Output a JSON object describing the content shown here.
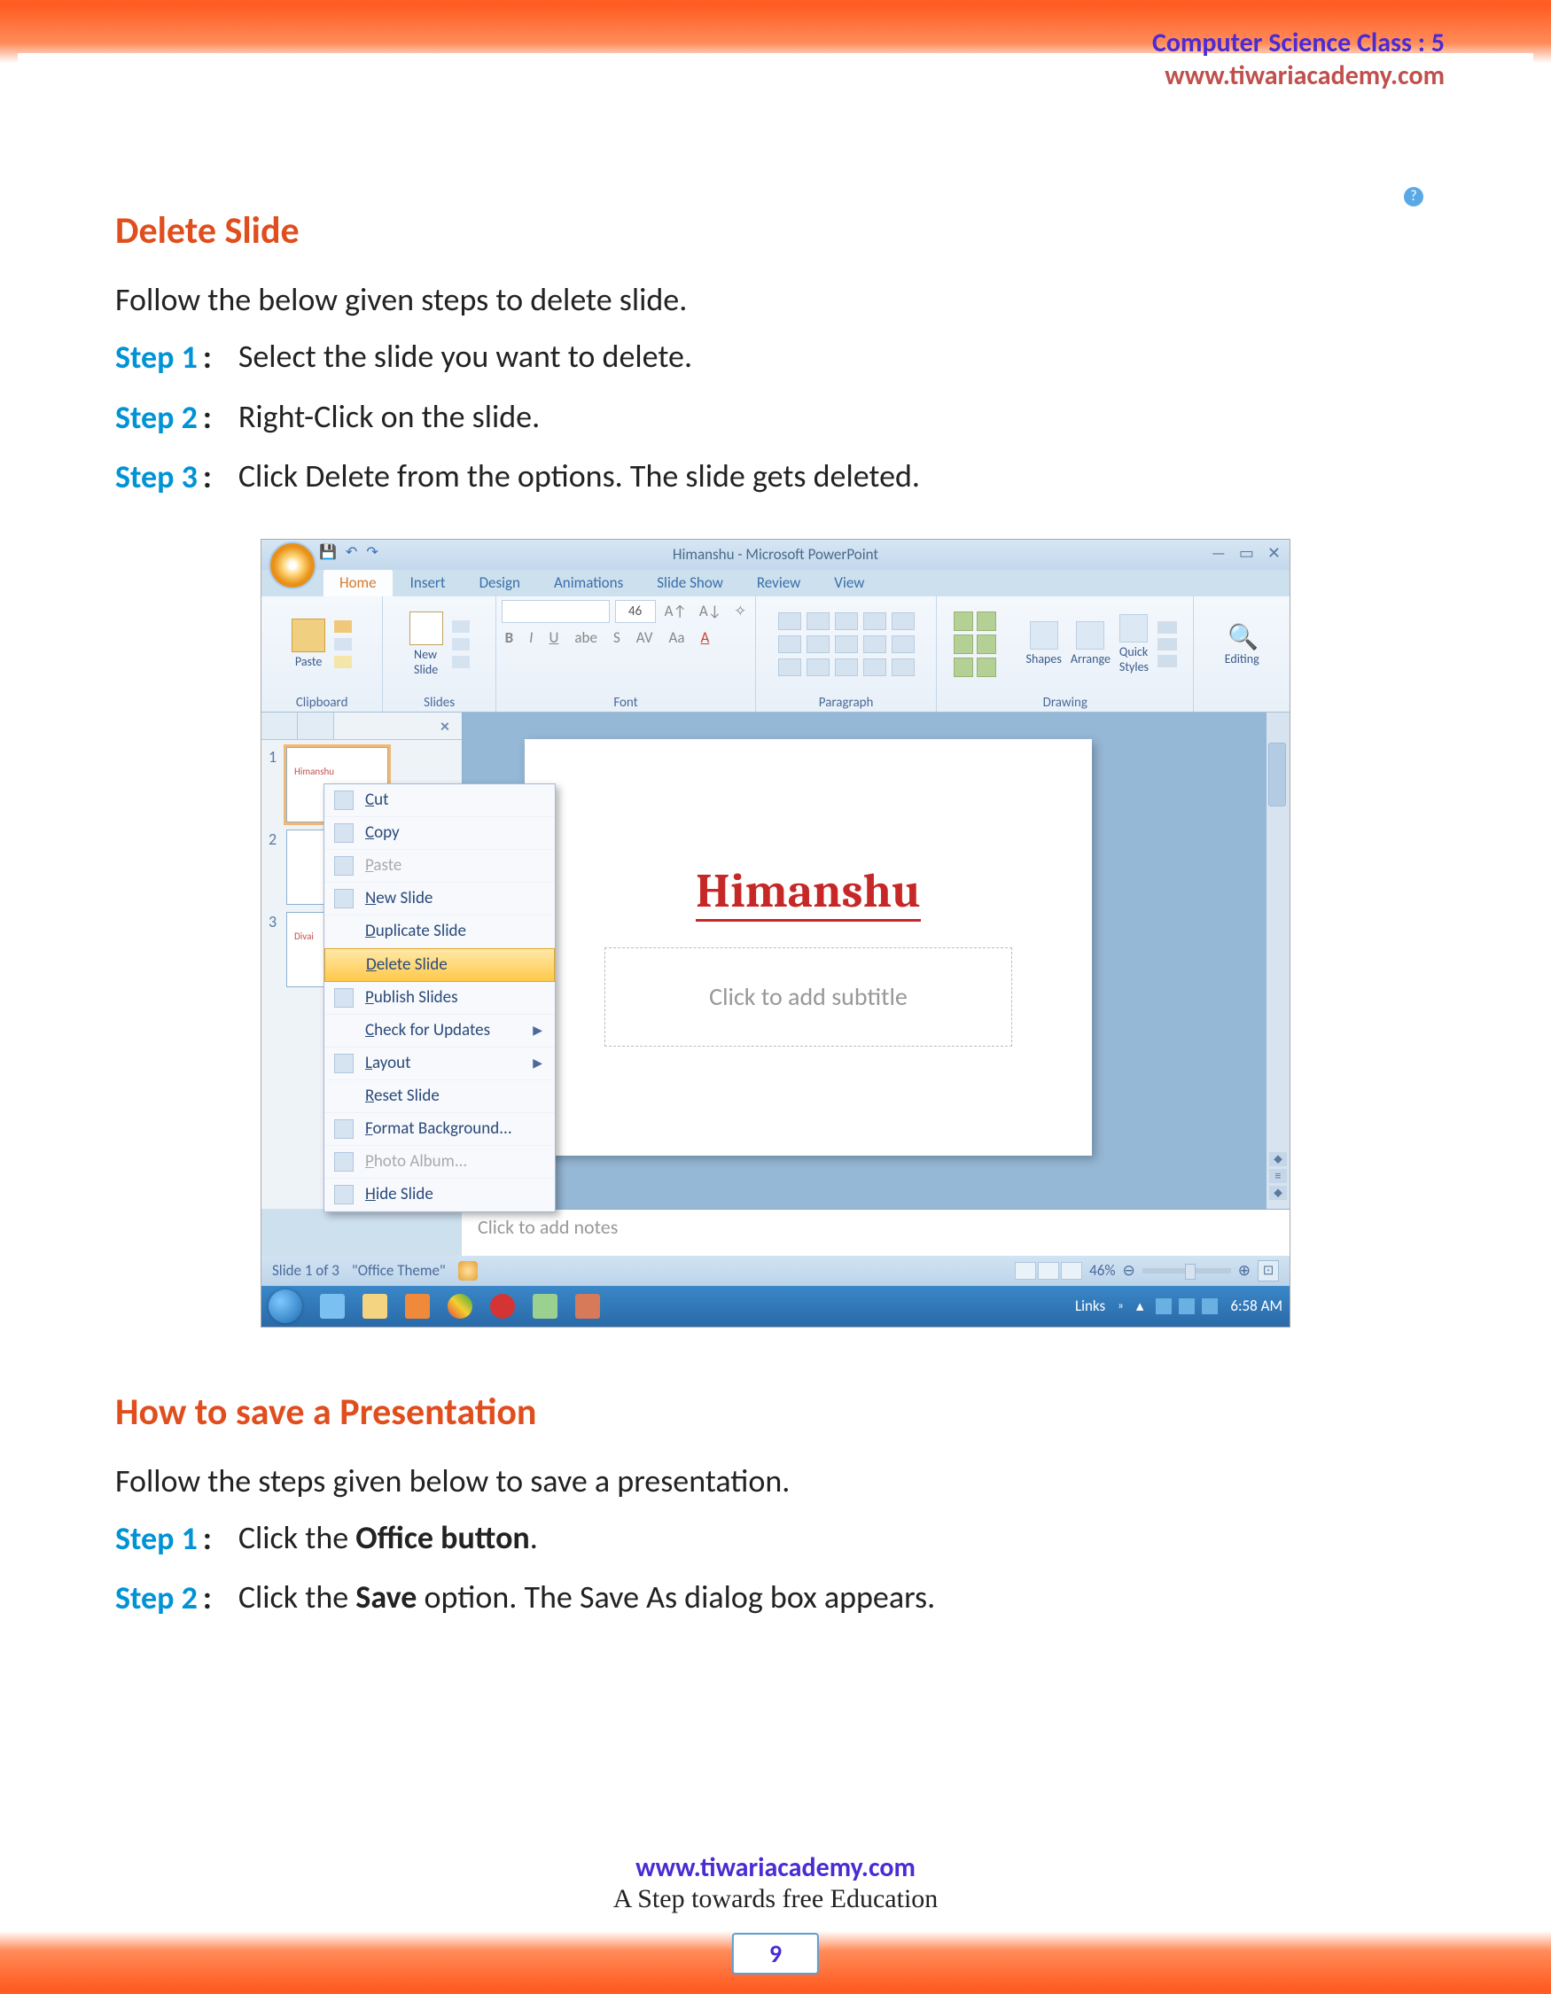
{
  "header": {
    "classLine": "Computer Science Class : 5",
    "site": "www.tiwariacademy.com"
  },
  "section1": {
    "title": "Delete Slide",
    "intro": "Follow the below given steps to delete slide.",
    "steps": [
      {
        "label": "Step 1",
        "text": "Select the slide you want to delete."
      },
      {
        "label": "Step 2",
        "text": "Right-Click on the slide."
      },
      {
        "label": "Step 3",
        "text": "Click Delete from the options. The slide gets deleted."
      }
    ]
  },
  "screenshot": {
    "title": "Himanshu - Microsoft PowerPoint",
    "tabs": [
      "Home",
      "Insert",
      "Design",
      "Animations",
      "Slide Show",
      "Review",
      "View"
    ],
    "groups": {
      "clipboard": "Clipboard",
      "slides": "Slides",
      "font": "Font",
      "paragraph": "Paragraph",
      "drawing": "Drawing",
      "editing": "Editing"
    },
    "pasteLabel": "Paste",
    "newSlideLabel": "New\nSlide",
    "fontSize": "46",
    "shapesLabel": "Shapes",
    "arrangeLabel": "Arrange",
    "quickStylesLabel": "Quick\nStyles",
    "thumbs": [
      {
        "num": "1",
        "text": "Himanshu"
      },
      {
        "num": "2",
        "text": ""
      },
      {
        "num": "3",
        "text": "Divai"
      }
    ],
    "context": [
      {
        "label": "Cut",
        "icon": true
      },
      {
        "label": "Copy",
        "icon": true
      },
      {
        "label": "Paste",
        "icon": true,
        "disabled": true
      },
      {
        "label": "New Slide",
        "icon": true
      },
      {
        "label": "Duplicate Slide"
      },
      {
        "label": "Delete Slide",
        "highlighted": true
      },
      {
        "label": "Publish Slides",
        "icon": true
      },
      {
        "label": "Check for Updates",
        "arrow": true
      },
      {
        "label": "Layout",
        "icon": true,
        "arrow": true
      },
      {
        "label": "Reset Slide"
      },
      {
        "label": "Format Background...",
        "icon": true
      },
      {
        "label": "Photo Album...",
        "icon": true,
        "disabled": true
      },
      {
        "label": "Hide Slide",
        "icon": true
      }
    ],
    "slideTitle": "Himanshu",
    "subtitlePlaceholder": "Click to add subtitle",
    "notesPlaceholder": "Click to add notes",
    "statusLeft": "Slide 1 of 3",
    "statusTheme": "\"Office Theme\"",
    "zoom": "46%",
    "links": "Links",
    "time": "6:58 AM"
  },
  "section2": {
    "title": "How to save a Presentation",
    "intro": "Follow the steps given below to save a presentation.",
    "steps": [
      {
        "label": "Step 1",
        "pre": "Click the ",
        "bold": "Office button",
        "post": "."
      },
      {
        "label": "Step 2",
        "pre": "Click the ",
        "bold": "Save",
        "post": " option. The Save As dialog box appears."
      }
    ]
  },
  "footer": {
    "site": "www.tiwariacademy.com",
    "tag": "A Step towards free Education",
    "page": "9"
  }
}
